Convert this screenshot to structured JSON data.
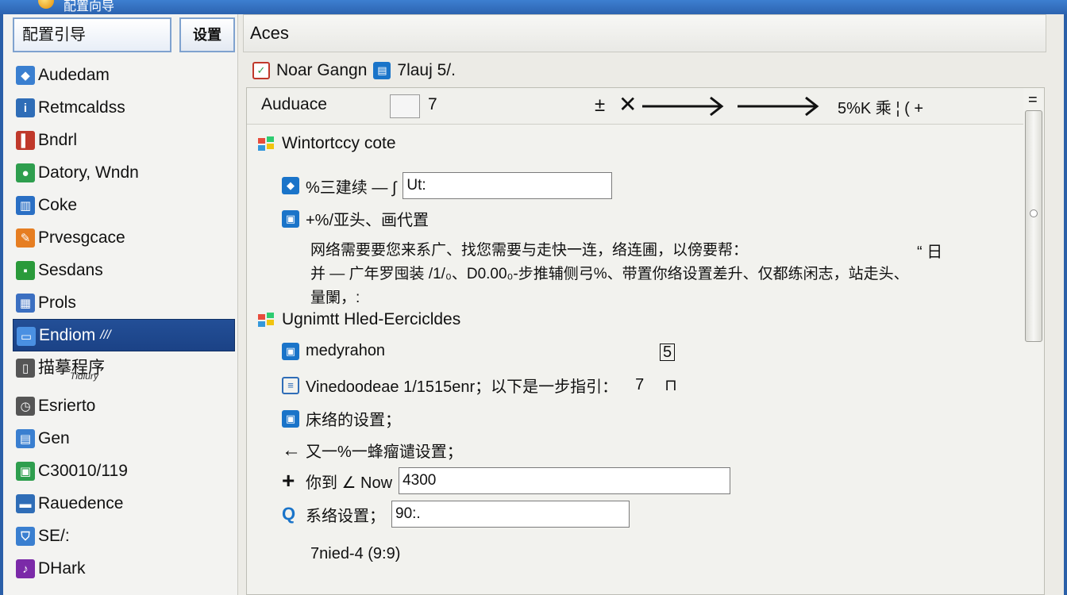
{
  "window": {
    "title": "配置向导"
  },
  "left": {
    "search_value": "配置引导",
    "button_label": "设置",
    "items": [
      {
        "label": "Audedam",
        "icon": "user-group-icon",
        "color": "#3a7fd0"
      },
      {
        "label": "Retmcaldss",
        "icon": "info-page-icon",
        "color": "#2f6db7"
      },
      {
        "label": "Bndrl",
        "icon": "book-icon",
        "color": "#c0392b"
      },
      {
        "label": "Datory, Wndn",
        "icon": "globe-icon",
        "color": "#2e9e4e"
      },
      {
        "label": "Coke",
        "icon": "column-icon",
        "color": "#2a6fc4"
      },
      {
        "label": "Prvesgcace",
        "icon": "brush-icon",
        "color": "#e67e22"
      },
      {
        "label": "Sesdans",
        "icon": "camera-icon",
        "color": "#2a9a3a"
      },
      {
        "label": "Prols",
        "icon": "chart-icon",
        "color": "#3b6fc1"
      },
      {
        "label": "Endiom",
        "icon": "window-icon",
        "color": "#4a90e2",
        "active": true,
        "suffix": "///"
      },
      {
        "label": "描摹程序",
        "sub": "Tidiury",
        "icon": "page-icon",
        "color": "#555555"
      },
      {
        "label": "Esrierto",
        "icon": "clock-icon",
        "color": "#555555"
      },
      {
        "label": "Gen",
        "icon": "grid-icon",
        "color": "#3a7fd0"
      },
      {
        "label": "C30010/119",
        "icon": "calendar-icon",
        "color": "#2e9e4e"
      },
      {
        "label": "Rauedence",
        "icon": "folder-icon",
        "color": "#2f6db7"
      },
      {
        "label": "SE/:",
        "icon": "shield-icon",
        "color": "#3a7fd0"
      },
      {
        "label": "DHark",
        "icon": "note-icon",
        "color": "#7b2aa8"
      }
    ]
  },
  "right": {
    "header": "Aces",
    "crumb": {
      "part1": "Noar Gangn",
      "part2": "7lauj 5/.",
      "icon1": "settings-icon",
      "icon2": "folder-icon"
    },
    "top": {
      "audience": "Auduace",
      "audience_value": "7",
      "plusminus": "±",
      "close": "✕",
      "flow_end": "5%K 乘 ¦ ( +",
      "scroll_up": "="
    },
    "section1": {
      "title": "Wintortccy cote",
      "row1_label": "%三建续 — ∫",
      "row1_value": "Ut:",
      "row2_label": "+%/亚头、画代置",
      "para_line1": "网络需要要您来系广、找您需要与走快一连，络连圃，以傍要帮：",
      "para_mark": "“ 日",
      "para_line2": "并 — 广年罗囤装 /1/₀、D0.00₀-步推辅侧弓%、带置你络设置差升、仅都练闲志，站走头、",
      "para_line3": "量闌，:"
    },
    "section2": {
      "title": "Ugnimtt Hled-Eercicldes",
      "row1_label": "medyrahon",
      "row1_mark": "5",
      "row2_label": "Vinedoodeae 1/1515enr；以下是一步指引：",
      "row2_value": "7",
      "row2_mark": "⊓",
      "row3_label": "床络的设置；",
      "row4_label": "又一%一蜂瘤谴设置；",
      "row5_label": "你到 ∠ Now",
      "row5_value": "4300",
      "row6_label": "系络设置；",
      "row6_value": "90:.",
      "footer": "7nied-4 (9:9)"
    }
  }
}
